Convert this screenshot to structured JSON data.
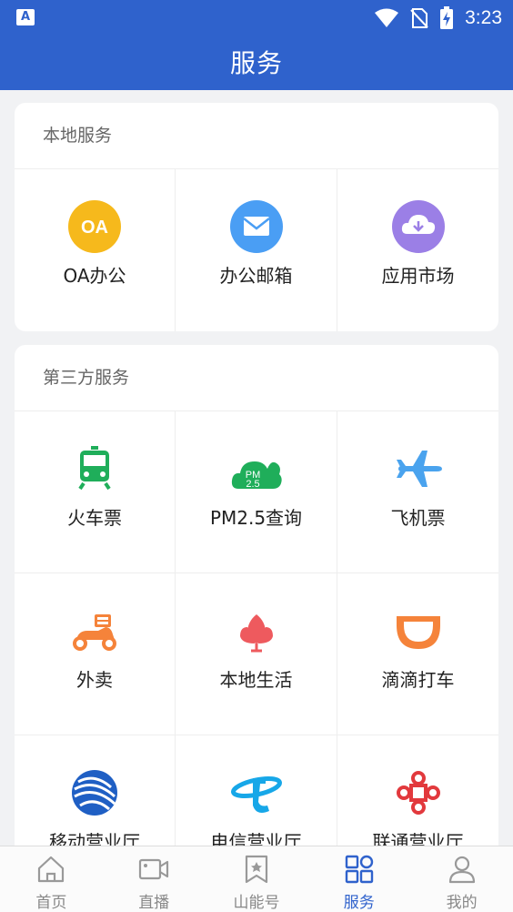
{
  "status_bar": {
    "time": "3:23"
  },
  "header": {
    "title": "服务"
  },
  "local_section": {
    "title": "本地服务",
    "items": [
      {
        "label": "OA办公",
        "icon": "oa-icon",
        "icon_text": "OA"
      },
      {
        "label": "办公邮箱",
        "icon": "mail-icon"
      },
      {
        "label": "应用市场",
        "icon": "cloud-download-icon"
      }
    ]
  },
  "third_party_section": {
    "title": "第三方服务",
    "items": [
      {
        "label": "火车票",
        "icon": "train-icon"
      },
      {
        "label": "PM2.5查询",
        "icon": "pm25-cloud-icon",
        "icon_text_top": "PM",
        "icon_text_bottom": "2.5"
      },
      {
        "label": "飞机票",
        "icon": "airplane-icon"
      },
      {
        "label": "外卖",
        "icon": "scooter-icon"
      },
      {
        "label": "本地生活",
        "icon": "lotus-icon"
      },
      {
        "label": "滴滴打车",
        "icon": "didi-icon"
      },
      {
        "label": "移动营业厅",
        "icon": "china-mobile-icon"
      },
      {
        "label": "电信营业厅",
        "icon": "china-telecom-icon"
      },
      {
        "label": "联通营业厅",
        "icon": "china-unicom-icon"
      }
    ]
  },
  "tab_bar": {
    "tabs": [
      {
        "label": "首页",
        "icon": "home-icon",
        "active": false
      },
      {
        "label": "直播",
        "icon": "video-icon",
        "active": false
      },
      {
        "label": "山能号",
        "icon": "bookmark-star-icon",
        "active": false
      },
      {
        "label": "服务",
        "icon": "grid-icon",
        "active": true
      },
      {
        "label": "我的",
        "icon": "person-icon",
        "active": false
      }
    ]
  },
  "colors": {
    "primary": "#2f62cc",
    "active_tab": "#2f62cc",
    "inactive_tab": "#888888"
  }
}
